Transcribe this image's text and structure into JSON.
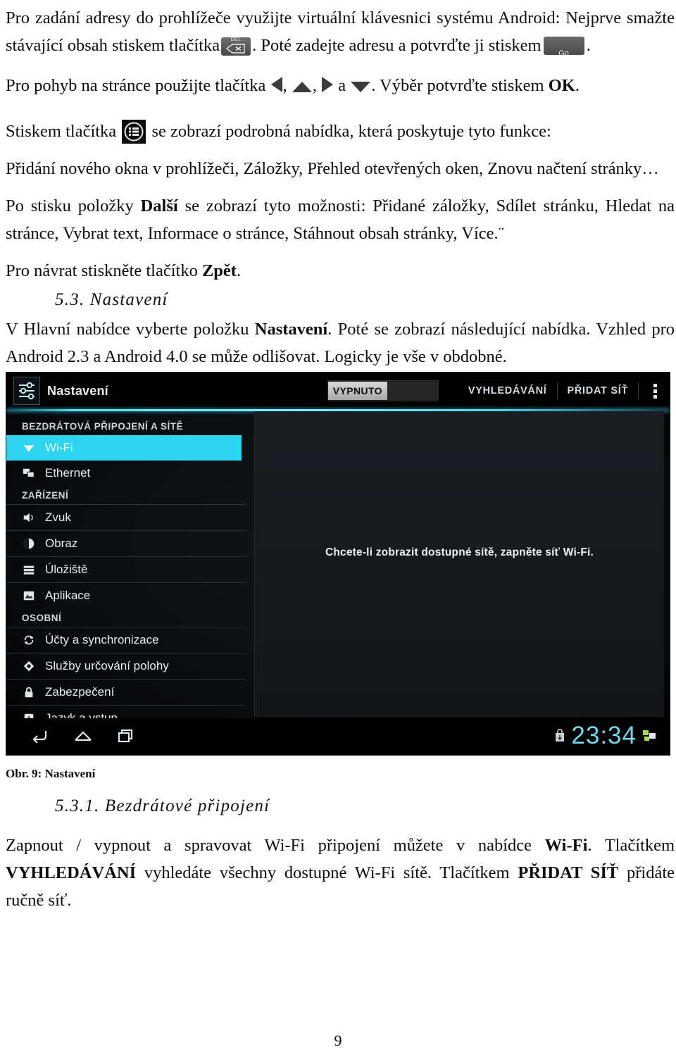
{
  "document": {
    "page_number": "9",
    "paragraphs": {
      "p1_a": "Pro zadání adresy do prohlížeče využijte virtuální klávesnici systému Android: Nejprve smažte stávající obsah stiskem tlačítka",
      "p1_b": ". Poté zadejte adresu a potvrďte ji stiskem",
      "p1_c": ".",
      "p2_a": "Pro pohyb na stránce použijte tlačítka",
      "p2_comma1": ",",
      "p2_comma2": ",",
      "p2_a_word": "a",
      "p2_b": ". Výběr potvrďte stiskem",
      "p2_ok": "OK",
      "p2_end": ".",
      "p3_a": "Stiskem tlačítka",
      "p3_b": "se zobrazí podrobná nabídka, která poskytuje tyto funkce:",
      "p4": "Přidání nového okna v prohlížeči, Záložky, Přehled otevřených oken, Znovu načtení stránky…",
      "p5_a": "Po stisku položky",
      "p5_bold": "Další",
      "p5_b": "se zobrazí tyto možnosti: Přidané záložky, Sdílet stránku, Hledat na stránce, Vybrat text, Informace o stránce, Stáhnout obsah stránky, Více.¨",
      "p6_a": "Pro návrat stiskněte tlačítko",
      "p6_bold": "Zpět",
      "p6_end": ".",
      "p7_a": "V Hlavní nabídce vyberte položku",
      "p7_bold": "Nastavení",
      "p7_b": ". Poté se zobrazí následující nabídka. Vzhled pro Android 2.3 a Android 4.0 se může odlišovat. Logicky je vše v obdobné.",
      "p8_a": "Zapnout / vypnout a spravovat Wi-Fi připojení můžete v nabídce",
      "p8_bold1": "Wi-Fi",
      "p8_b": ". Tlačítkem",
      "p8_bold2": "VYHLEDÁVÁNÍ",
      "p8_c": "vyhledáte všechny dostupné Wi-Fi sítě. Tlačítkem",
      "p8_bold3": "PŘIDAT SÍŤ",
      "p8_d": "přidáte ručně síť."
    },
    "headings": {
      "h1": "5.3. Nastavení",
      "h2": "5.3.1. Bezdrátové připojení"
    },
    "figure_caption": "Obr. 9: Nastavení",
    "inline_icons": {
      "del_key_label": "DEL",
      "del_key_name": "backspace-key-icon",
      "go_key_label": "Go",
      "go_key_name": "go-key-icon",
      "menu_key_name": "menu-key-icon",
      "arrow_left_name": "arrow-left-icon",
      "arrow_up_name": "arrow-up-icon",
      "arrow_right_name": "arrow-right-icon",
      "arrow_down_name": "arrow-down-icon"
    }
  },
  "screenshot": {
    "header": {
      "title": "Nastavení",
      "settings_icon": "settings-sliders-icon",
      "toggle_label": "VYPNUTO",
      "action_scan": "VYHLEDÁVÁNÍ",
      "action_add_network": "PŘIDAT SÍŤ",
      "overflow_icon": "overflow-menu-icon"
    },
    "sidebar": {
      "groups": [
        {
          "label": "BEZDRÁTOVÁ PŘIPOJENÍ A SÍTĚ",
          "items": [
            {
              "label": "Wi-Fi",
              "icon": "wifi-icon",
              "active": true
            },
            {
              "label": "Ethernet",
              "icon": "ethernet-icon",
              "active": false
            }
          ]
        },
        {
          "label": "ZAŘÍZENÍ",
          "items": [
            {
              "label": "Zvuk",
              "icon": "sound-icon",
              "active": false
            },
            {
              "label": "Obraz",
              "icon": "display-icon",
              "active": false
            },
            {
              "label": "Úložiště",
              "icon": "storage-icon",
              "active": false
            },
            {
              "label": "Aplikace",
              "icon": "apps-icon",
              "active": false
            }
          ]
        },
        {
          "label": "OSOBNÍ",
          "items": [
            {
              "label": "Účty a synchronizace",
              "icon": "sync-icon",
              "active": false
            },
            {
              "label": "Služby určování polohy",
              "icon": "location-icon",
              "active": false
            },
            {
              "label": "Zabezpečení",
              "icon": "lock-icon",
              "active": false
            },
            {
              "label": "Jazyk a vstup",
              "icon": "language-icon",
              "active": false
            }
          ]
        }
      ]
    },
    "content": {
      "empty_message": "Chcete-li zobrazit dostupné sítě, zapněte síť Wi-Fi."
    },
    "navbar": {
      "back_icon": "back-icon",
      "home_icon": "home-icon",
      "recents_icon": "recents-icon",
      "clock": "23:34",
      "lock_icon": "usb-lock-icon",
      "network_icon": "network-icon"
    },
    "colors": {
      "accent_cyan": "#2fd4ef",
      "clock_cyan": "#6fd9ef",
      "background": "#000000"
    }
  }
}
